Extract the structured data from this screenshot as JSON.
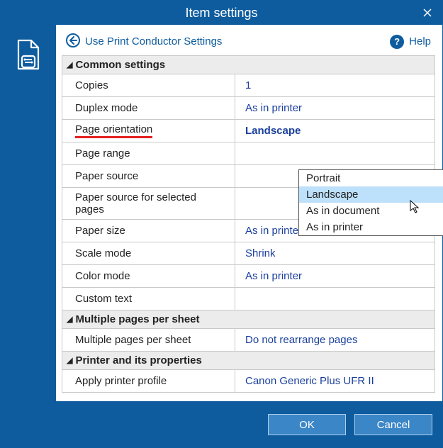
{
  "window": {
    "title": "Item settings"
  },
  "toolbar": {
    "use_conductor": "Use Print Conductor Settings",
    "help": "Help"
  },
  "sections": {
    "common": {
      "header": "Common settings",
      "rows": {
        "copies": {
          "label": "Copies",
          "value": "1"
        },
        "duplex": {
          "label": "Duplex mode",
          "value": "As in printer"
        },
        "orientation": {
          "label": "Page orientation",
          "value": "Landscape"
        },
        "range": {
          "label": "Page range",
          "value": ""
        },
        "source": {
          "label": "Paper source",
          "value": ""
        },
        "source_selected": {
          "label": "Paper source for selected pages",
          "value": ""
        },
        "size": {
          "label": "Paper size",
          "value": "As in printer"
        },
        "scale": {
          "label": "Scale mode",
          "value": "Shrink"
        },
        "color": {
          "label": "Color mode",
          "value": "As in printer"
        },
        "custom": {
          "label": "Custom text",
          "value": ""
        }
      }
    },
    "multi": {
      "header": "Multiple pages per sheet",
      "rows": {
        "mps": {
          "label": "Multiple pages per sheet",
          "value": "Do not rearrange pages"
        }
      }
    },
    "printer": {
      "header": "Printer and its properties",
      "rows": {
        "profile": {
          "label": "Apply printer profile",
          "value": "Canon Generic Plus UFR II"
        }
      }
    }
  },
  "dropdown": {
    "options": [
      "Portrait",
      "Landscape",
      "As in document",
      "As in printer"
    ],
    "selected": "Landscape"
  },
  "buttons": {
    "ok": "OK",
    "cancel": "Cancel"
  }
}
